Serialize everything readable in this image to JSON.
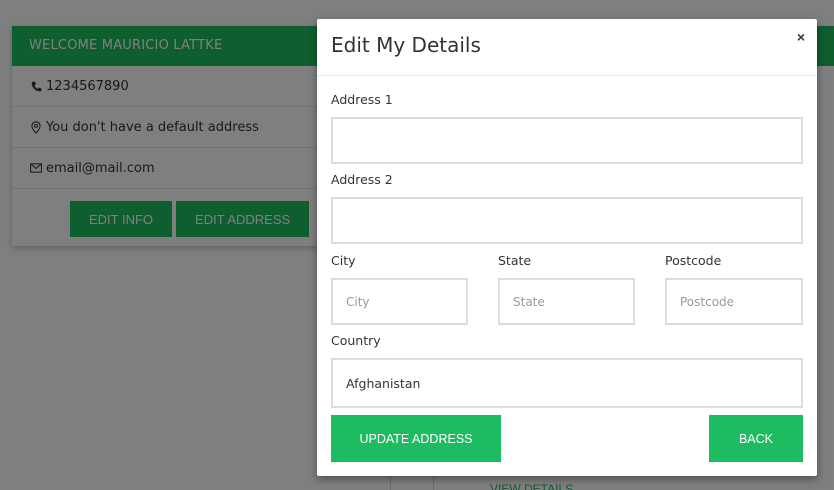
{
  "profile": {
    "header": "WELCOME MAURICIO LATTKE",
    "phone": "1234567890",
    "address": "You don't have a default address",
    "email": "email@mail.com",
    "edit_info_label": "EDIT INFO",
    "edit_address_label": "EDIT ADDRESS"
  },
  "background": {
    "view_details_label": "VIEW DETAILS"
  },
  "modal": {
    "title": "Edit My Details",
    "close_label": "×",
    "fields": {
      "address1_label": "Address 1",
      "address1_value": "",
      "address2_label": "Address 2",
      "address2_value": "",
      "city_label": "City",
      "city_placeholder": "City",
      "state_label": "State",
      "state_placeholder": "State",
      "postcode_label": "Postcode",
      "postcode_placeholder": "Postcode",
      "country_label": "Country",
      "country_value": "Afghanistan"
    },
    "update_label": "UPDATE ADDRESS",
    "back_label": "BACK"
  },
  "colors": {
    "accent": "#1ebc61",
    "overlay": "#00000080"
  },
  "icons": {
    "phone": "phone-icon",
    "location": "map-pin-icon",
    "email": "envelope-icon",
    "close": "close-icon"
  }
}
